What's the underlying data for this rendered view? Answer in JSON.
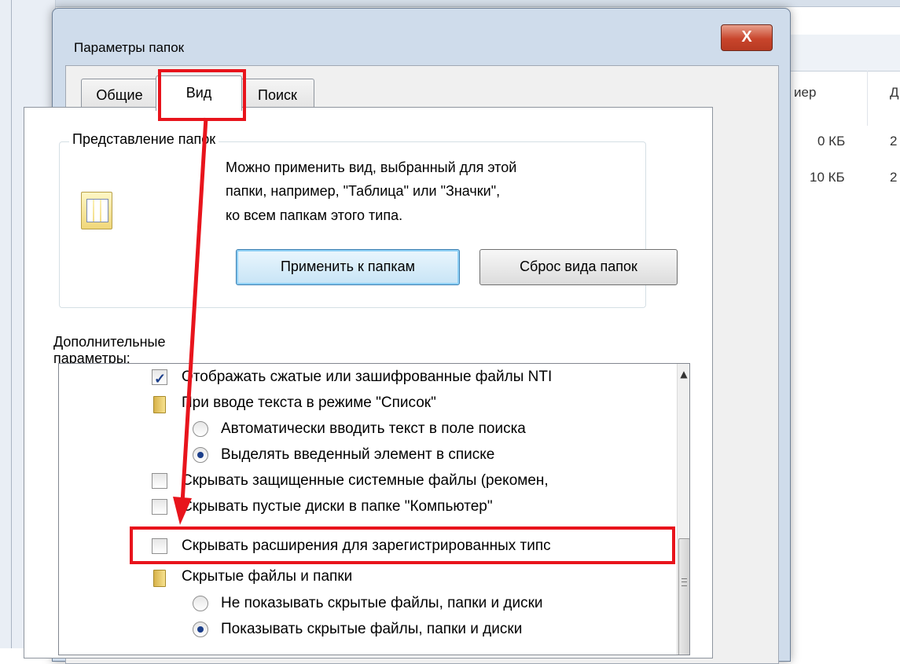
{
  "dialog": {
    "title": "Параметры папок",
    "close_label": "X"
  },
  "tabs": [
    {
      "label": "Общие"
    },
    {
      "label": "Вид"
    },
    {
      "label": "Поиск"
    }
  ],
  "folder_views": {
    "caption": "Представление папок",
    "description_lines": [
      "Можно применить вид, выбранный для этой",
      "папки, например, \"Таблица\" или \"Значки\",",
      "ко всем папкам этого типа."
    ],
    "apply_button": "Применить к папкам",
    "reset_button": "Сброс вида папок"
  },
  "advanced": {
    "label": "Дополнительные параметры:",
    "items": [
      {
        "type": "checkbox",
        "checked": true,
        "label": "Отображать сжатые или зашифрованные файлы NTI"
      },
      {
        "type": "folder",
        "label": "При вводе текста в режиме \"Список\""
      },
      {
        "type": "radio",
        "checked": false,
        "label": "Автоматически вводить текст в поле поиска"
      },
      {
        "type": "radio",
        "checked": true,
        "label": "Выделять введенный элемент в списке"
      },
      {
        "type": "checkbox",
        "checked": false,
        "label": "Скрывать защищенные системные файлы (рекомен,"
      },
      {
        "type": "checkbox",
        "checked": false,
        "label": "Скрывать пустые диски в папке \"Компьютер\""
      },
      {
        "type": "checkbox",
        "checked": false,
        "label": "Скрывать расширения для зарегистрированных типс"
      },
      {
        "type": "folder",
        "label": "Скрытые файлы и папки"
      },
      {
        "type": "radio",
        "checked": false,
        "label": "Не показывать скрытые файлы, папки и диски"
      },
      {
        "type": "radio",
        "checked": true,
        "label": "Показывать скрытые файлы, папки и диски"
      }
    ]
  },
  "background": {
    "col_header_size": "иер",
    "col_header_date": "Д",
    "rows": [
      {
        "size": "0 КБ",
        "date": "2"
      },
      {
        "size": "10 КБ",
        "date": "2"
      }
    ]
  },
  "colors": {
    "highlight": "#e8141c",
    "dialog_frame": "#cfdceb"
  }
}
